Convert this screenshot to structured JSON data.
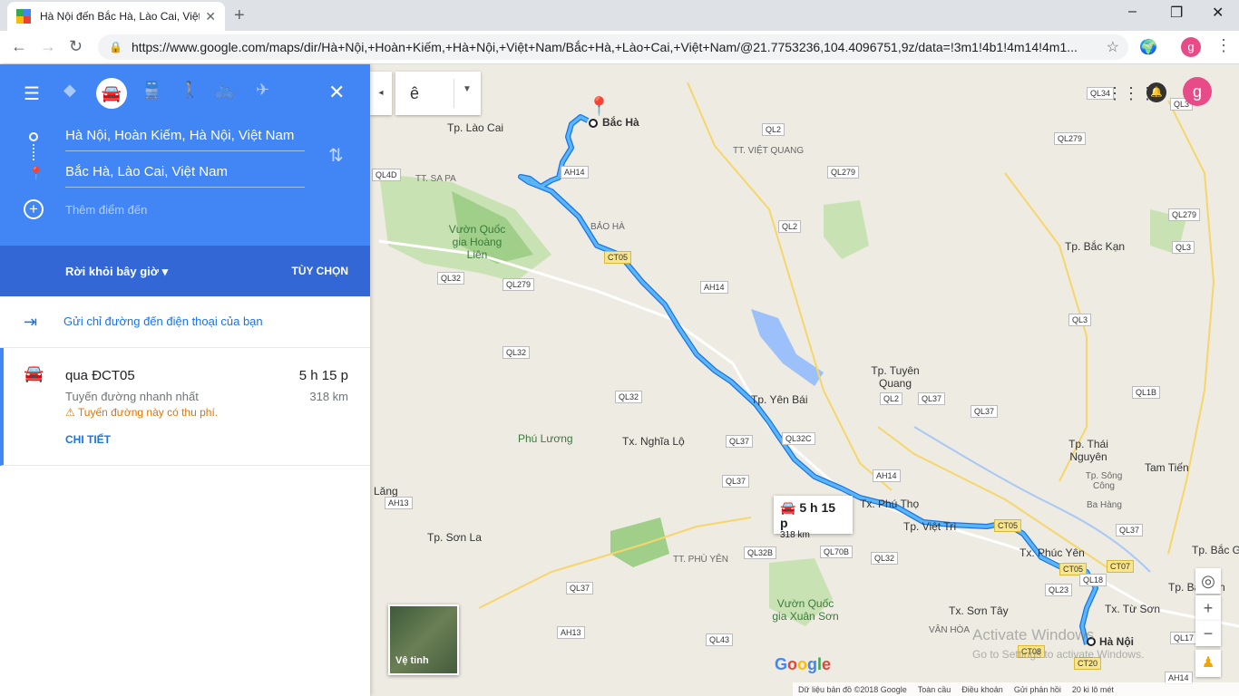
{
  "browser": {
    "tab_title": "Hà Nội đến Bắc Hà, Lào Cai, Việt",
    "url": "https://www.google.com/maps/dir/Hà+Nội,+Hoàn+Kiếm,+Hà+Nội,+Việt+Nam/Bắc+Hà,+Lào+Cai,+Việt+Nam/@21.7753236,104.4096751,9z/data=!3m1!4b1!4m14!4m1...",
    "profile_initial": "g"
  },
  "sidebar": {
    "origin": "Hà Nội, Hoàn Kiếm, Hà Nội, Việt Nam",
    "destination": "Bắc Hà, Lào Cai, Việt Nam",
    "add_destination": "Thêm điểm đến",
    "depart_label": "Rời khỏi bây giờ",
    "options_label": "TÙY CHỌN",
    "send_label": "Gửi chỉ đường đến điện thoại của bạn",
    "route": {
      "via": "qua ĐCT05",
      "time": "5 h 15 p",
      "note": "Tuyến đường nhanh nhất",
      "distance": "318 km",
      "toll": "Tuyến đường này có thu phí.",
      "detail": "CHI TIẾT"
    }
  },
  "map": {
    "ime_char": "ê",
    "profile_initial": "g",
    "popup_time": "5 h 15 p",
    "popup_dist": "318 km",
    "satellite_label": "Vệ tinh",
    "google_logo": "Google",
    "watermark_1": "Activate Windows",
    "watermark_2": "Go to Settings to activate Windows.",
    "footer": {
      "data": "Dữ liệu bản đồ ©2018 Google",
      "global": "Toàn cầu",
      "terms": "Điều khoản",
      "feedback": "Gửi phản hồi",
      "scale": "20 ki lô mét"
    },
    "places": {
      "bac_ha": "Bắc Hà",
      "ha_noi": "Hà Nội",
      "lao_cai": "Tp. Lào Cai",
      "sapa": "TT. SA PA",
      "vqg_hoang_lien": "Vườn Quốc gia Hoàng Liên",
      "bao_ha": "BẢO HÀ",
      "viet_quang": "TT. VIỆT QUANG",
      "bac_kan": "Tp. Bắc Kạn",
      "tuyen_quang": "Tp. Tuyên Quang",
      "yen_bai": "Tp. Yên Bái",
      "phu_luong": "Phú Lương",
      "nghia_lo": "Tx. Nghĩa Lộ",
      "thai_nguyen": "Tp. Thái Nguyên",
      "song_cong": "Tp. Sông Công",
      "tam_tien": "Tam Tiến",
      "bac_giang": "Tp. Bắc Gian",
      "phu_tho": "Tx. Phú Thọ",
      "viet_tri": "Tp. Việt Trì",
      "phuc_yen": "Tx. Phúc Yên",
      "bac_ninh": "Tp. Bắc Nin",
      "tu_son": "Tx. Từ Sơn",
      "son_tay": "Tx. Sơn Tây",
      "van_hoa": "VÂN HÒA",
      "son_la": "Tp. Sơn La",
      "phu_yen": "TT. PHÙ YÊN",
      "vqg_xuan_son": "Vườn Quốc gia Xuân Sơn",
      "lang": "Lăng",
      "ba_hang": "Ba Hàng"
    },
    "roads": [
      "QL34",
      "QL3",
      "QL279",
      "QL2",
      "QL4D",
      "AH14",
      "QL279",
      "QL2",
      "QL279",
      "QL3",
      "CT05",
      "AH14",
      "QL32",
      "QL279",
      "QL3",
      "QL32",
      "QL32",
      "QL2",
      "QL37",
      "QL1B",
      "QL37",
      "QL37",
      "QL32C",
      "AH14",
      "AH13",
      "QL37",
      "CT05",
      "QL37",
      "QL32B",
      "QL70B",
      "QL32",
      "CT05",
      "CT07",
      "QL18",
      "QL23",
      "QL37",
      "AH13",
      "QL43",
      "CT08",
      "CT20",
      "QL17",
      "AH14"
    ]
  }
}
